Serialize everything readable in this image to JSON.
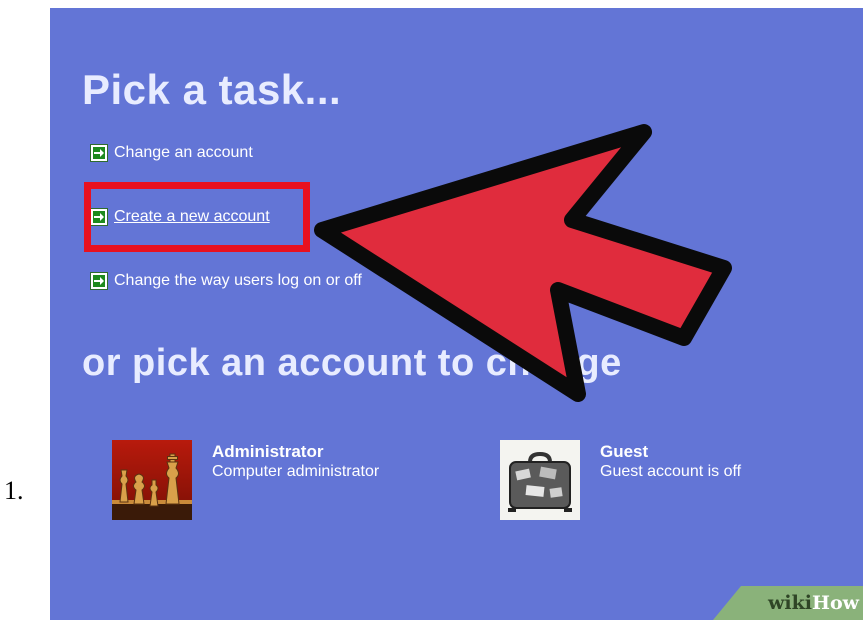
{
  "list_marker": "1.",
  "heading_tasks": "Pick a task...",
  "tasks": [
    {
      "label": "Change an account",
      "icon": "green-arrow-icon"
    },
    {
      "label": "Create a new account",
      "icon": "green-arrow-icon"
    },
    {
      "label": "Change the way users log on or off",
      "icon": "green-arrow-icon"
    }
  ],
  "heading_accounts": "or pick an account to change",
  "accounts": [
    {
      "name": "Administrator",
      "desc": "Computer administrator",
      "avatar": "chess-pieces-icon"
    },
    {
      "name": "Guest",
      "desc": "Guest account is off",
      "avatar": "suitcase-icon"
    }
  ],
  "watermark": {
    "part1": "wiki",
    "part2": "How"
  },
  "colors": {
    "panel_bg": "#6375d6",
    "highlight": "#e8111f",
    "pointer_arrow": "#e02c3d",
    "task_arrow": "#1d8a1d"
  }
}
